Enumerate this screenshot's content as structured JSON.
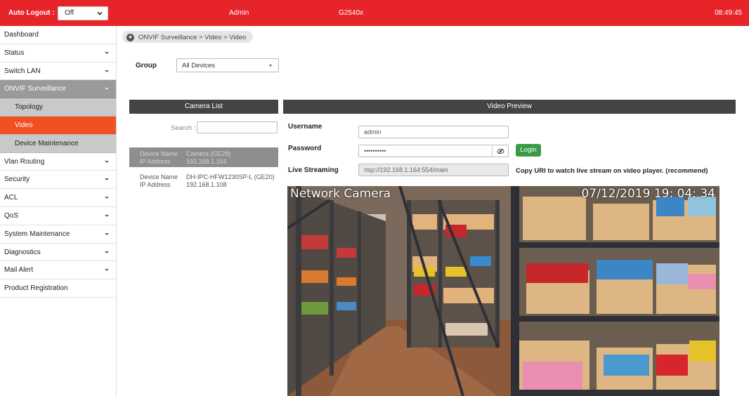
{
  "topbar": {
    "auto_logout_label": "Auto Logout :",
    "auto_logout_value": "Off",
    "user": "Admin",
    "model": "G2540x",
    "time": "08:49:45",
    "accent_color": "#e8242b"
  },
  "sidebar": {
    "items": [
      {
        "label": "Dashboard"
      },
      {
        "label": "Status"
      },
      {
        "label": "Switch LAN"
      },
      {
        "label": "ONVIF Surveillance"
      },
      {
        "label": "Topology"
      },
      {
        "label": "Video"
      },
      {
        "label": "Device Maintenance"
      },
      {
        "label": "Vlan Routing"
      },
      {
        "label": "Security"
      },
      {
        "label": "ACL"
      },
      {
        "label": "QoS"
      },
      {
        "label": "System Maintenance"
      },
      {
        "label": "Diagnostics"
      },
      {
        "label": "Mail Alert"
      },
      {
        "label": "Product Registration"
      }
    ]
  },
  "breadcrumb": "ONVIF Surveillance > Video > Video",
  "group": {
    "label": "Group",
    "value": "All Devices"
  },
  "camera_list": {
    "title": "Camera List",
    "search_label": "Search :",
    "search_value": "",
    "device_name_key": "Device Name",
    "ip_key": "IP Address",
    "cameras": [
      {
        "name": "Camera (GE28)",
        "ip": "192.168.1.164"
      },
      {
        "name": "DH-IPC-HFW1230SP-L (GE20)",
        "ip": "192.168.1.108"
      }
    ]
  },
  "preview": {
    "title": "Video Preview",
    "username_label": "Username",
    "username_value": "admin",
    "password_label": "Password",
    "password_value": "••••••••••",
    "login_label": "Login",
    "live_label": "Live Streaming",
    "live_value": "rtsp://192.168.1.164:554/main",
    "copy_hint": "Copy URI to watch live stream on video player. (recommend)",
    "osd_title": "Network Camera",
    "osd_time": "07/12/2019  19: 04: 34",
    "login_color": "#3a9b46"
  }
}
